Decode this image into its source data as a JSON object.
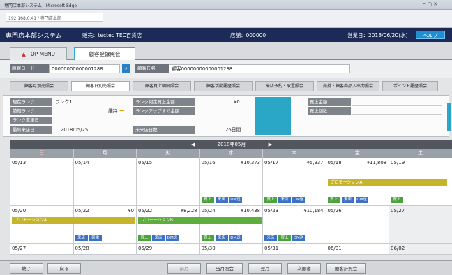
{
  "browser": {
    "title": "専門店本部システム - Microsoft Edge",
    "address": "192.168.0.41 / 専門店本部"
  },
  "header": {
    "app_title": "専門店本部システム",
    "company": "販売：tectec TEC百貨店",
    "store": "店舗：000000",
    "business_date": "営業日：2018/06/20(水)",
    "help": "ヘルプ"
  },
  "topnav": {
    "home": "TOP MENU",
    "current": "顧客登録照会"
  },
  "form": {
    "customer_code_label": "顧客コード",
    "customer_code_value": "00000000000001288",
    "customer_name_label": "顧客氏名",
    "customer_name_value": "顧客00000000000001288"
  },
  "subtabs": [
    "顧客月別売照会",
    "顧客日別売照会",
    "顧客買上明細照会",
    "顧客活動履歴照会",
    "来店予約・取置照会",
    "売掛・顧客商品入出力照会",
    "ポイント履歴照会"
  ],
  "info": {
    "rank_label": "現在ランク",
    "rank_value": "ランク1",
    "pre_rank_label": "前期ランク",
    "pre_rank_value": "",
    "maintain_label": "維持",
    "maintain_icon": "arrow",
    "rank_date_label": "ランク変更日",
    "rank_date_value": "",
    "last_visit_label": "最終来店日",
    "last_visit_value": "2018/05/25",
    "rank_amount_label": "ランク判定買上金額",
    "rank_amount_value": "¥0",
    "rank_up_label": "ランクアップまで金額",
    "rank_up_value": "",
    "elapsed_label": "未来店日数",
    "elapsed_value": "26日間",
    "purchase_amount_label": "買上金額",
    "purchase_amount_value": "",
    "purchase_count_label": "買上回数",
    "purchase_count_value": ""
  },
  "calendar": {
    "month": "2018年05月",
    "prev": "◀",
    "next": "▶",
    "weekdays": [
      "日",
      "月",
      "火",
      "水",
      "木",
      "金",
      "土"
    ],
    "weeks": [
      [
        "05/13",
        "05/14",
        "05/15",
        "05/16",
        "05/17",
        "05/18",
        "05/19"
      ],
      [
        "05/20",
        "05/22",
        "05/22",
        "05/24",
        "05/23",
        "05/26",
        "05/27"
      ],
      [
        "05/27",
        "05/28",
        "05/29",
        "05/30",
        "05/31",
        "06/01",
        "06/02"
      ]
    ],
    "amounts": {
      "w0d3": "¥10,373",
      "w0d4": "¥5,937",
      "w0d5": "¥11,808",
      "w1d1": "¥0",
      "w1d2": "¥8,228",
      "w1d3": "¥10,438",
      "w1d4": "¥10,184"
    },
    "promo": "プロモーションA",
    "promo_b": "プロモーションB",
    "chip_buy": "買上",
    "chip_visit": "来店",
    "chip_dm": "DM送付",
    "chip_call": "架電"
  },
  "bottom": {
    "end": "終了",
    "back": "戻る",
    "prev_label": "前月",
    "month_report": "当月照会",
    "next_label": "翌月",
    "before_label": "次顧客",
    "summary": "顧客計照会"
  },
  "colors": {
    "header_bg": "#1b2a57",
    "accent_blue": "#2ca7d4",
    "promo_yellow": "#c6b42a",
    "promo_green": "#5fae3d",
    "chip_blue": "#3c72c4"
  }
}
